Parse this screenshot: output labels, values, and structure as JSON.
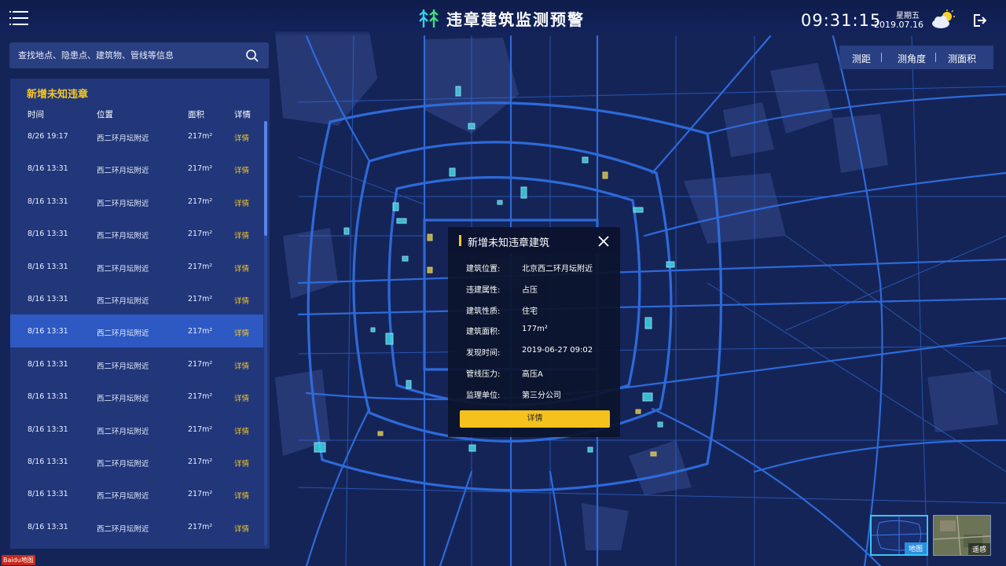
{
  "header": {
    "menu_icon": "hamburger-menu-icon",
    "logo_icon": "forest-logo-icon",
    "title": "违章建筑监测预警",
    "time": "09:31:15",
    "weekday": "星期五",
    "date": "2019.07.16",
    "weather_icon": "partly-cloudy-sun-icon",
    "exit_icon": "logout-icon"
  },
  "search": {
    "placeholder": "查找地点、隐患点、建筑物、管线等信息",
    "icon": "search-icon"
  },
  "list_panel": {
    "title": "新增未知违章",
    "columns": [
      "时间",
      "位置",
      "面积",
      "详情"
    ],
    "rows": [
      {
        "time": "8/26 19:17",
        "location": "西二环月坛附近",
        "area": "217m²",
        "action": "详情"
      },
      {
        "time": "8/16 13:31",
        "location": "西二环月坛附近",
        "area": "217m²",
        "action": "详情"
      },
      {
        "time": "8/16 13:31",
        "location": "西二环月坛附近",
        "area": "217m²",
        "action": "详情"
      },
      {
        "time": "8/16 13:31",
        "location": "西二环月坛附近",
        "area": "217m²",
        "action": "详情"
      },
      {
        "time": "8/16 13:31",
        "location": "西二环月坛附近",
        "area": "217m²",
        "action": "详情"
      },
      {
        "time": "8/16 13:31",
        "location": "西二环月坛附近",
        "area": "217m²",
        "action": "详情"
      },
      {
        "time": "8/16 13:31",
        "location": "西二环月坛附近",
        "area": "217m²",
        "action": "详情",
        "selected": true
      },
      {
        "time": "8/16 13:31",
        "location": "西二环月坛附近",
        "area": "217m²",
        "action": "详情"
      },
      {
        "time": "8/16 13:31",
        "location": "西二环月坛附近",
        "area": "217m²",
        "action": "详情"
      },
      {
        "time": "8/16 13:31",
        "location": "西二环月坛附近",
        "area": "217m²",
        "action": "详情"
      },
      {
        "time": "8/16 13:31",
        "location": "西二环月坛附近",
        "area": "217m²",
        "action": "详情"
      },
      {
        "time": "8/16 13:31",
        "location": "西二环月坛附近",
        "area": "217m²",
        "action": "详情"
      },
      {
        "time": "8/16 13:31",
        "location": "西二环月坛附近",
        "area": "217m²",
        "action": "详情"
      }
    ]
  },
  "tools": {
    "distance": "测距",
    "angle": "测角度",
    "area": "测面积"
  },
  "popup": {
    "title": "新增未知违章建筑",
    "close_icon": "close-icon",
    "fields": [
      {
        "label": "建筑位置:",
        "value": "北京西二环月坛附近"
      },
      {
        "label": "违建属性:",
        "value": "占压"
      },
      {
        "label": "建筑性质:",
        "value": "住宅"
      },
      {
        "label": "建筑面积:",
        "value": "177m²"
      },
      {
        "label": "发现时间:",
        "value": "2019-06-27 09:02"
      },
      {
        "label": "管线压力:",
        "value": "高压A"
      },
      {
        "label": "监理单位:",
        "value": "第三分公司"
      }
    ],
    "button": "详情"
  },
  "layers": {
    "map": "地图",
    "satellite": "遥感"
  },
  "attribution": "Baidu地图",
  "colors": {
    "background": "#152457",
    "road": "#2f6ee0",
    "accent_yellow": "#f5c626",
    "marker_cyan": "#3fd6e6",
    "marker_yellow": "#d9c24a"
  }
}
